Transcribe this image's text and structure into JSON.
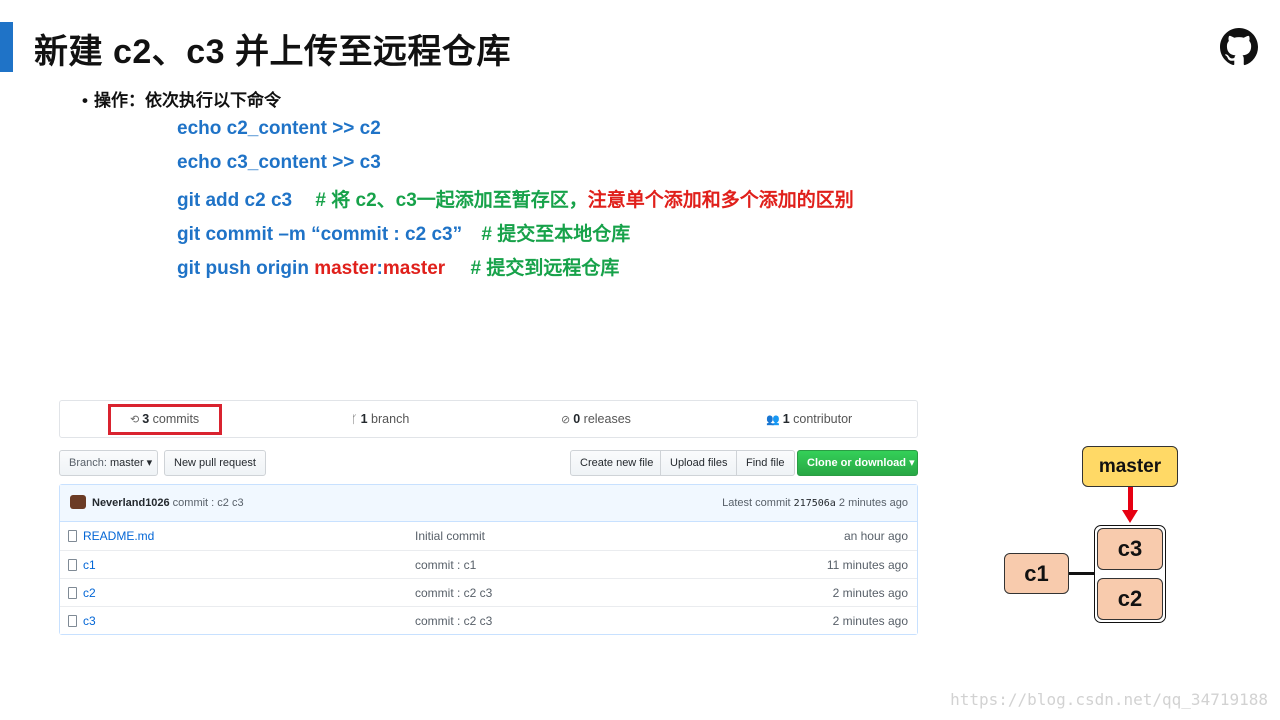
{
  "slide": {
    "title": "新建 c2、c3 并上传至远程仓库",
    "bullet": "操作：依次执行以下命令",
    "accent_color": "#1f73c7"
  },
  "commands": {
    "line1": "echo c2_content >> c2",
    "line2": "echo c3_content >> c3",
    "line3_cmd": "git add c2 c3",
    "line3_comment": "# 将 c2、c3一起添加至暂存区，",
    "line3_note": "注意单个添加和多个添加的区别",
    "line4_cmd": "git commit –m “commit : c2 c3”",
    "line4_comment": "# 提交至本地仓库",
    "line5_cmd": "git push origin ",
    "line5_branch1": "master",
    "line5_colon": ":",
    "line5_branch2": "master",
    "line5_comment": "# 提交到远程仓库"
  },
  "github": {
    "stats": {
      "commits_count": "3",
      "commits_label": "commits",
      "branch_count": "1",
      "branch_label": "branch",
      "releases_count": "0",
      "releases_label": "releases",
      "contributor_count": "1",
      "contributor_label": "contributor"
    },
    "toolbar": {
      "branch_prefix": "Branch:",
      "branch_name": "master",
      "new_pr": "New pull request",
      "create_file": "Create new file",
      "upload_files": "Upload files",
      "find_file": "Find file",
      "clone": "Clone or download"
    },
    "latest": {
      "author": "Neverland1026",
      "message": "commit : c2 c3",
      "prefix": "Latest commit",
      "sha": "217506a",
      "age": "2 minutes ago"
    },
    "files": [
      {
        "name": "README.md",
        "message": "Initial commit",
        "age": "an hour ago"
      },
      {
        "name": "c1",
        "message": "commit : c1",
        "age": "11 minutes ago"
      },
      {
        "name": "c2",
        "message": "commit : c2 c3",
        "age": "2 minutes ago"
      },
      {
        "name": "c3",
        "message": "commit : c2 c3",
        "age": "2 minutes ago"
      }
    ]
  },
  "diagram": {
    "master": "master",
    "c1": "c1",
    "c2": "c2",
    "c3": "c3"
  },
  "watermark": "https://blog.csdn.net/qq_34719188"
}
